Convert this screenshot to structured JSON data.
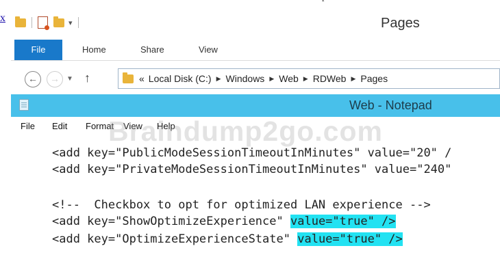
{
  "stray_link": "x",
  "top_caption": "p",
  "explorer": {
    "title": "Pages",
    "ribbon_tabs": {
      "file": "File",
      "home": "Home",
      "share": "Share",
      "view": "View"
    },
    "address": {
      "prefix": "«",
      "crumbs": [
        "Local Disk (C:)",
        "Windows",
        "Web",
        "RDWeb",
        "Pages"
      ]
    }
  },
  "notepad": {
    "title": "Web - Notepad",
    "menu": {
      "file": "File",
      "edit": "Edit",
      "format": "Format",
      "view": "View",
      "help": "Help"
    },
    "watermark": "Braindump2go.com",
    "lines": {
      "l1": "<add key=\"PublicModeSessionTimeoutInMinutes\" value=\"20\" /",
      "l2": "<add key=\"PrivateModeSessionTimeoutInMinutes\" value=\"240\"",
      "l4": "<!--  Checkbox to opt for optimized LAN experience -->",
      "l5_a": "<add key=\"ShowOptimizeExperience\" ",
      "l5_b": "value=\"true\" />",
      "l6_a": "<add key=\"OptimizeExperienceState\" ",
      "l6_b": "value=\"true\" />"
    },
    "highlight_color": "#22e2f2"
  }
}
